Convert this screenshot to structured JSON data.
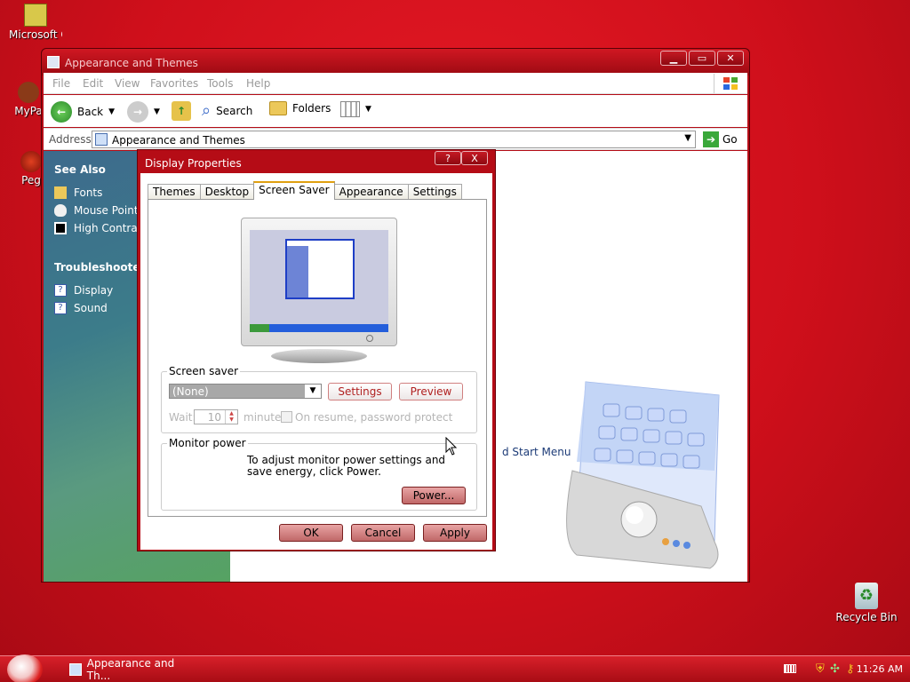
{
  "desktop": {
    "icons": [
      {
        "label": "Microsoft Outlo",
        "icon": "outlook-icon"
      },
      {
        "label": "MyPa",
        "icon": "user-folder-icon"
      },
      {
        "label": "Peg",
        "icon": "pegasus-icon"
      },
      {
        "label": "Recycle Bin",
        "icon": "recycle-bin-icon"
      }
    ]
  },
  "explorer": {
    "title": "Appearance and Themes",
    "menu": [
      "File",
      "Edit",
      "View",
      "Favorites",
      "Tools",
      "Help"
    ],
    "toolbar": {
      "back": "Back",
      "search": "Search",
      "folders": "Folders"
    },
    "address": {
      "label": "Address",
      "value": "Appearance and Themes",
      "go": "Go"
    },
    "left_pane": {
      "see_also": "See Also",
      "see_also_items": [
        "Fonts",
        "Mouse Pointe",
        "High Contras"
      ],
      "troubleshooters": "Troubleshooters",
      "troubleshooter_items": [
        "Display",
        "Sound"
      ]
    },
    "content_text": "d Start Menu"
  },
  "dialog": {
    "title": "Display Properties",
    "title_buttons": [
      "?",
      "X"
    ],
    "tabs": [
      "Themes",
      "Desktop",
      "Screen Saver",
      "Appearance",
      "Settings"
    ],
    "active_tab": "Screen Saver",
    "screen_saver": {
      "legend": "Screen saver",
      "selected": "(None)",
      "settings_btn": "Settings",
      "preview_btn": "Preview",
      "wait_label": "Wait:",
      "wait_value": "10",
      "minutes_label": "minutes",
      "resume_label": "On resume, password protect"
    },
    "monitor_power": {
      "legend": "Monitor power",
      "text": "To adjust monitor power settings and save energy, click Power.",
      "power_btn": "Power..."
    },
    "buttons": {
      "ok": "OK",
      "cancel": "Cancel",
      "apply": "Apply"
    }
  },
  "taskbar": {
    "task": "Appearance and Th...",
    "clock": "11:26 AM"
  }
}
